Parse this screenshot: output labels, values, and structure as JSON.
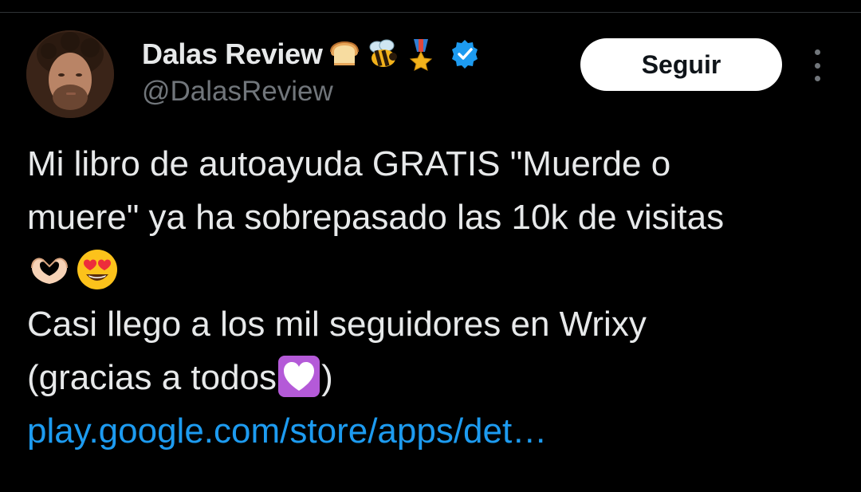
{
  "author": {
    "display_name": "Dalas Review",
    "handle": "@DalasReview",
    "name_emojis": [
      "bread-emoji",
      "bee-emoji",
      "military-medal-emoji"
    ],
    "verified": true
  },
  "actions": {
    "follow_label": "Seguir"
  },
  "tweet": {
    "line1": "Mi libro de autoayuda GRATIS \"Muerde o",
    "line2": "muere\" ya ha sobrepasado las 10k de visitas",
    "line3_emojis": [
      "heart-hands-emoji",
      "smiling-face-with-heart-eyes-emoji"
    ],
    "line4": "Casi llego a los mil seguidores en Wrixy",
    "line5": "(gracias a todos",
    "line5_emoji": "white-heart-emoji",
    "line5_end": ")",
    "link": "play.google.com/store/apps/det…"
  },
  "colors": {
    "background": "#000000",
    "text": "#e7e9ea",
    "secondary_text": "#71767b",
    "link": "#1d9bf0",
    "verified_badge": "#1d9bf0",
    "follow_button_bg": "#ffffff"
  }
}
